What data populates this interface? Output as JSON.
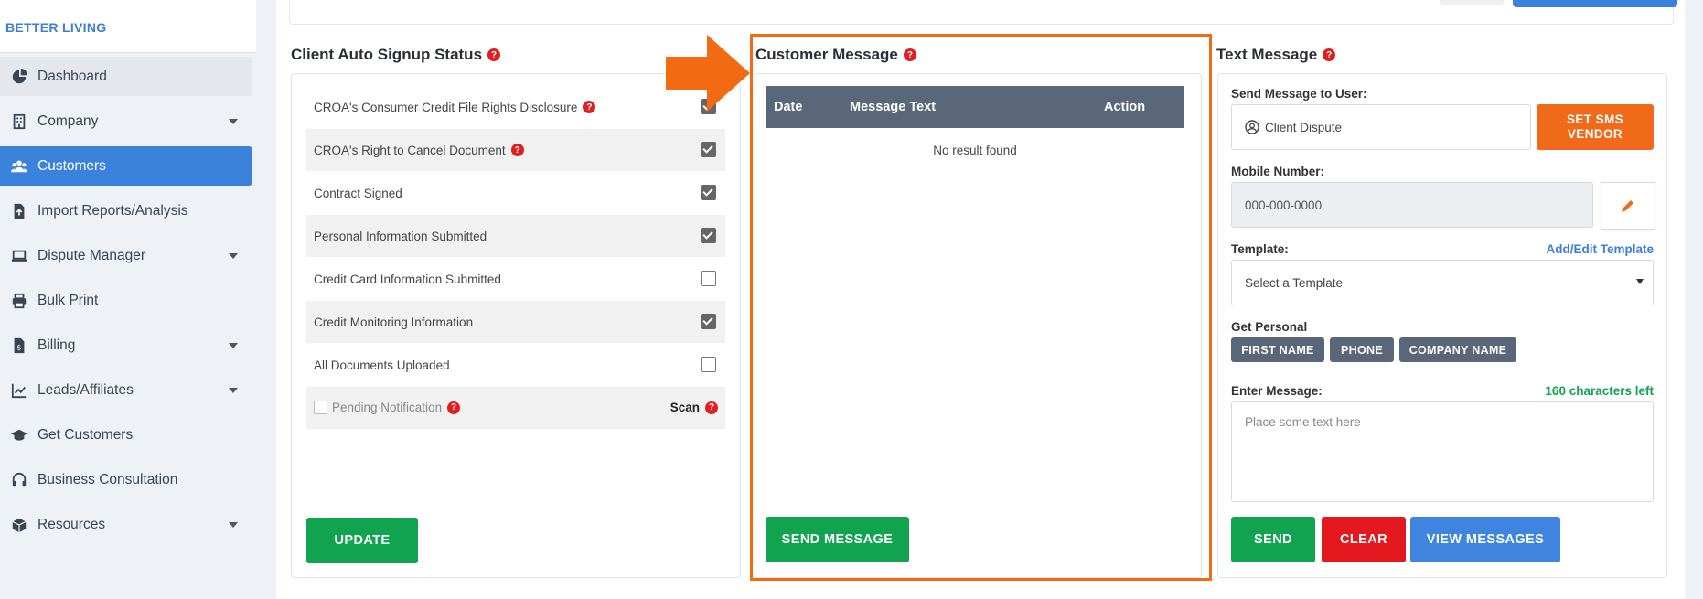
{
  "brand": "BETTER LIVING",
  "sidebar": {
    "items": [
      {
        "label": "Dashboard",
        "icon": "dashboard-icon",
        "caret": false
      },
      {
        "label": "Company",
        "icon": "building-icon",
        "caret": true
      },
      {
        "label": "Customers",
        "icon": "users-icon",
        "caret": false,
        "active": true
      },
      {
        "label": "Import Reports/Analysis",
        "icon": "file-import-icon",
        "caret": false
      },
      {
        "label": "Dispute Manager",
        "icon": "laptop-icon",
        "caret": true
      },
      {
        "label": "Bulk Print",
        "icon": "printer-icon",
        "caret": false
      },
      {
        "label": "Billing",
        "icon": "invoice-icon",
        "caret": true
      },
      {
        "label": "Leads/Affiliates",
        "icon": "chart-line-icon",
        "caret": true
      },
      {
        "label": "Get Customers",
        "icon": "graduation-cap-icon",
        "caret": false
      },
      {
        "label": "Business Consultation",
        "icon": "headset-icon",
        "caret": false
      },
      {
        "label": "Resources",
        "icon": "box-icon",
        "caret": true
      }
    ]
  },
  "signup": {
    "title": "Client Auto Signup Status",
    "rows": [
      {
        "label": "CROA's Consumer Credit File Rights Disclosure",
        "help": true,
        "checked": true
      },
      {
        "label": "CROA's Right to Cancel Document",
        "help": true,
        "checked": true
      },
      {
        "label": "Contract Signed",
        "help": false,
        "checked": true
      },
      {
        "label": "Personal Information Submitted",
        "help": false,
        "checked": true
      },
      {
        "label": "Credit Card Information Submitted",
        "help": false,
        "checked": false
      },
      {
        "label": "Credit Monitoring Information",
        "help": false,
        "checked": true
      },
      {
        "label": "All Documents Uploaded",
        "help": false,
        "checked": false
      }
    ],
    "pending_label": "Pending Notification",
    "scan_label": "Scan",
    "update_button": "UPDATE"
  },
  "customer_message": {
    "title": "Customer Message",
    "columns": {
      "date": "Date",
      "message": "Message Text",
      "action": "Action"
    },
    "empty": "No result found",
    "send_button": "SEND MESSAGE"
  },
  "text_message": {
    "title": "Text Message",
    "send_to_label": "Send Message to User:",
    "send_to_value": "Client Dispute",
    "sms_vendor_button": "SET SMS VENDOR",
    "mobile_label": "Mobile Number:",
    "mobile_placeholder": "000-000-0000",
    "template_label": "Template:",
    "template_link": "Add/Edit Template",
    "template_select": "Select a Template",
    "personal_label": "Get Personal",
    "tags": [
      "FIRST NAME",
      "PHONE",
      "COMPANY NAME"
    ],
    "message_label": "Enter Message:",
    "chars_left": "160 characters left",
    "message_placeholder": "Place some text here",
    "send_button": "SEND",
    "clear_button": "CLEAR",
    "view_button": "VIEW MESSAGES"
  },
  "colors": {
    "highlight": "#f26a11",
    "active_nav": "#3b82dc",
    "green": "#11a350"
  }
}
